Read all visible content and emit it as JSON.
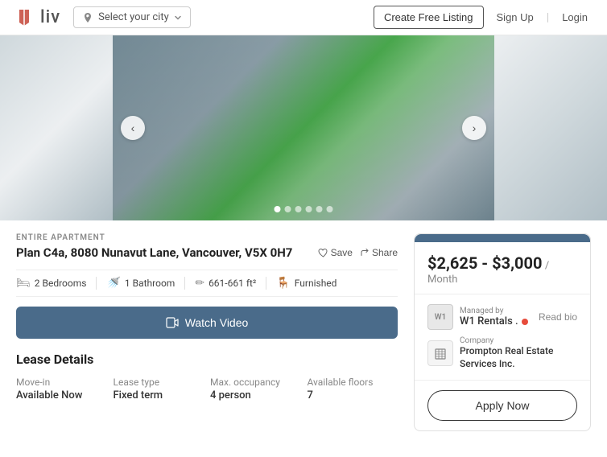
{
  "header": {
    "logo_text": "liv",
    "city_placeholder": "Select your city",
    "create_listing_label": "Create Free Listing",
    "signup_label": "Sign Up",
    "login_label": "Login"
  },
  "gallery": {
    "arrow_left": "‹",
    "arrow_right": "›",
    "dots": [
      true,
      false,
      false,
      false,
      false,
      false
    ]
  },
  "listing": {
    "type": "ENTIRE APARTMENT",
    "title": "Plan C4a, 8080 Nunavut Lane, Vancouver, V5X 0H7",
    "save_label": "Save",
    "share_label": "Share",
    "features": [
      {
        "icon": "🛏",
        "text": "2 Bedrooms"
      },
      {
        "icon": "🚿",
        "text": "1 Bathroom"
      },
      {
        "icon": "✏",
        "text": "661-661 ft²"
      },
      {
        "icon": "🪑",
        "text": "Furnished"
      }
    ],
    "watch_video_label": "Watch Video",
    "lease_section_title": "Lease Details",
    "lease_items": [
      {
        "label": "Move-in",
        "value": "Available Now"
      },
      {
        "label": "Lease type",
        "value": "Fixed term"
      },
      {
        "label": "Max. occupancy",
        "value": "4 person"
      },
      {
        "label": "Available floors",
        "value": "7"
      }
    ]
  },
  "sidebar": {
    "price_range": "$2,625 - $3,000",
    "price_period": "/ Month",
    "managed_by_label": "Managed by",
    "manager_name": "W1 Rentals .",
    "w1_avatar": "W1",
    "read_bio_label": "Read bio",
    "company_label": "Company",
    "company_name": "Prompton Real Estate Services Inc.",
    "apply_label": "Apply Now",
    "company_icon": "🏢"
  }
}
